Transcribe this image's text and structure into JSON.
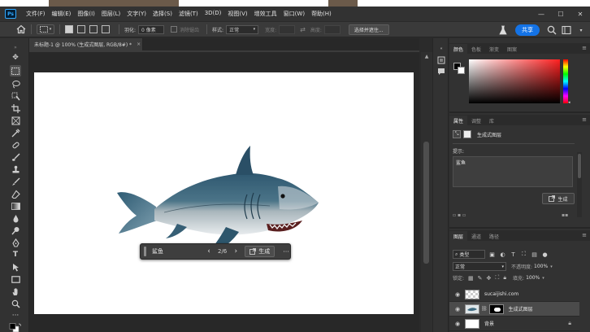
{
  "app": {
    "logo": "Ps",
    "menu": [
      "文件(F)",
      "编辑(E)",
      "图像(I)",
      "图层(L)",
      "文字(Y)",
      "选择(S)",
      "滤镜(T)",
      "3D(D)",
      "视图(V)",
      "增效工具",
      "窗口(W)",
      "帮助(H)"
    ],
    "window_controls": [
      "—",
      "☐",
      "✕"
    ]
  },
  "options": {
    "feather_label": "羽化:",
    "feather_value": "0 像素",
    "antialias_label": "消除锯齿",
    "style_label": "样式:",
    "style_value": "正常",
    "width_label": "宽度:",
    "height_label": "高度:",
    "select_subject": "选择并遮住...",
    "share": "共享"
  },
  "document": {
    "tab_title": "未标题-1 @ 100% (生成式图层, RGB/8#) *",
    "close": "×"
  },
  "taskbar": {
    "prompt_value": "鲨鱼",
    "counter": "2/6",
    "generate": "生成",
    "more": "···"
  },
  "color_panel": {
    "tabs": [
      "颜色",
      "色板",
      "渐变",
      "图案"
    ],
    "foreground": "#000000",
    "background": "#ffffff"
  },
  "properties_panel": {
    "tabs": [
      "属性",
      "调整",
      "库"
    ],
    "layer_type": "生成式图层",
    "prompt_label": "提示:",
    "prompt_value": "鲨鱼",
    "generate": "生成"
  },
  "layers_panel": {
    "tabs": [
      "图层",
      "通道",
      "路径"
    ],
    "filter_kind": "类型",
    "blend_mode": "正常",
    "opacity_label": "不透明度:",
    "opacity": "100%",
    "lock_label": "锁定:",
    "fill_label": "填充:",
    "fill": "100%",
    "layers": [
      {
        "name": "sucaijishi.com",
        "thumb": "checker",
        "selected": false
      },
      {
        "name": "生成式图层",
        "thumb": "shark",
        "selected": true
      },
      {
        "name": "背景",
        "thumb": "white",
        "selected": false
      }
    ]
  }
}
